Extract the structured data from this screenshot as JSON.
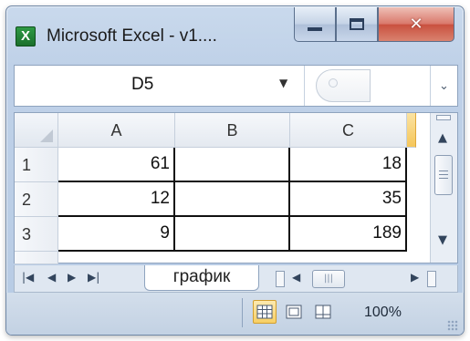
{
  "window": {
    "title": "Microsoft Excel - v1....",
    "app_icon_letter": "X"
  },
  "formula_bar": {
    "name_box": "D5",
    "formula": ""
  },
  "grid": {
    "columns": [
      "A",
      "B",
      "C"
    ],
    "rows": [
      {
        "header": "1",
        "cells": [
          "61",
          "",
          "18"
        ]
      },
      {
        "header": "2",
        "cells": [
          "12",
          "",
          "35"
        ]
      },
      {
        "header": "3",
        "cells": [
          "9",
          "",
          "189"
        ]
      }
    ]
  },
  "sheet_tabs": [
    {
      "label": "график",
      "active": true
    }
  ],
  "status_bar": {
    "zoom": "100%"
  },
  "colors": {
    "accent_active": "#f5c65a",
    "close_button": "#c9503e",
    "chrome": "#bfd1e8"
  }
}
